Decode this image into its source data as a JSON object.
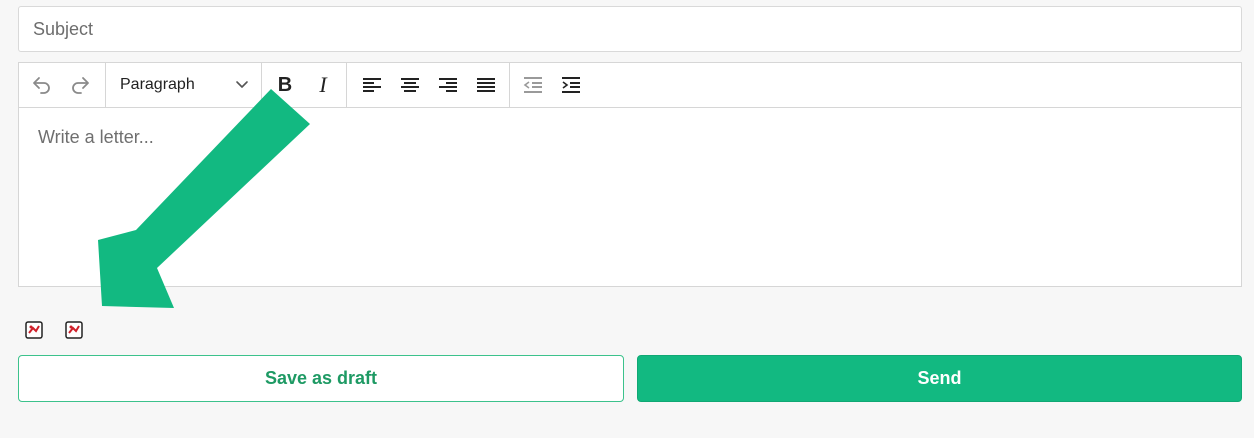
{
  "subject": {
    "placeholder": "Subject",
    "value": ""
  },
  "toolbar": {
    "undo_icon": "undo-icon",
    "redo_icon": "redo-icon",
    "format_select": {
      "selected": "Paragraph"
    },
    "bold_glyph": "B",
    "italic_glyph": "I",
    "align_icons": [
      "align-left-icon",
      "align-center-icon",
      "align-right-icon",
      "align-justify-icon"
    ],
    "indent_icons": [
      "outdent-icon",
      "indent-icon"
    ]
  },
  "editor": {
    "placeholder": "Write a letter..."
  },
  "annotation": {
    "color": "#12b981",
    "icon": "arrow-icon"
  },
  "attachments": {
    "icons": [
      "broken-image-icon",
      "broken-image-icon"
    ]
  },
  "actions": {
    "save_draft_label": "Save as draft",
    "send_label": "Send"
  },
  "colors": {
    "accent": "#12b981",
    "draft_text": "#1e9a64"
  }
}
